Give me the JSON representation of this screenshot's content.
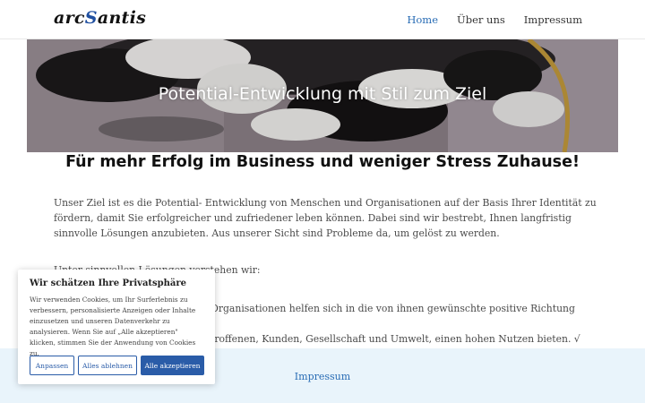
{
  "header": {
    "logo_prefix": "arc",
    "logo_s": "S",
    "logo_suffix": "antis",
    "nav": [
      "Home",
      "Über uns",
      "Impressum"
    ]
  },
  "hero": {
    "title": "Potential-Entwicklung mit Stil zum Ziel"
  },
  "main": {
    "subtitle": "Für mehr Erfolg im Business und weniger Stress Zuhause!",
    "paragraph": "Unser Ziel ist es die Potential- Entwicklung von Menschen und Organisationen auf der Basis Ihrer Identität zu fördern, damit Sie erfolgreicher und zufriedener leben können. Dabei sind wir bestrebt, Ihnen langfristig sinnvolle Lösungen anzubieten. Aus unserer Sicht sind Probleme da, um gelöst zu werden.",
    "list_intro": "Unter sinnvollen Lösungen verstehen wir:",
    "list_item_1": "Organisationen helfen sich in die von ihnen gewünschte positive Richtung",
    "list_item_2": "troffenen, Kunden, Gesellschaft und Umwelt, einen hohen Nutzen bieten. √"
  },
  "footer": {
    "link": "Impressum"
  },
  "cookie": {
    "title": "Wir schätzen Ihre Privatsphäre",
    "text": "Wir verwenden Cookies, um Ihr Surferlebnis zu verbessern, personalisierte Anzeigen oder Inhalte einzusetzen und unseren Datenverkehr zu analysieren. Wenn Sie auf „Alle akzeptieren\" klicken, stimmen Sie der Anwendung von Cookies zu.",
    "btn_customize": "Anpassen",
    "btn_reject": "Alles ablehnen",
    "btn_accept": "Alle akzeptieren"
  },
  "colors": {
    "accent": "#2a5ca8",
    "link": "#2a6db5",
    "footer_bg": "#e9f4fb"
  }
}
